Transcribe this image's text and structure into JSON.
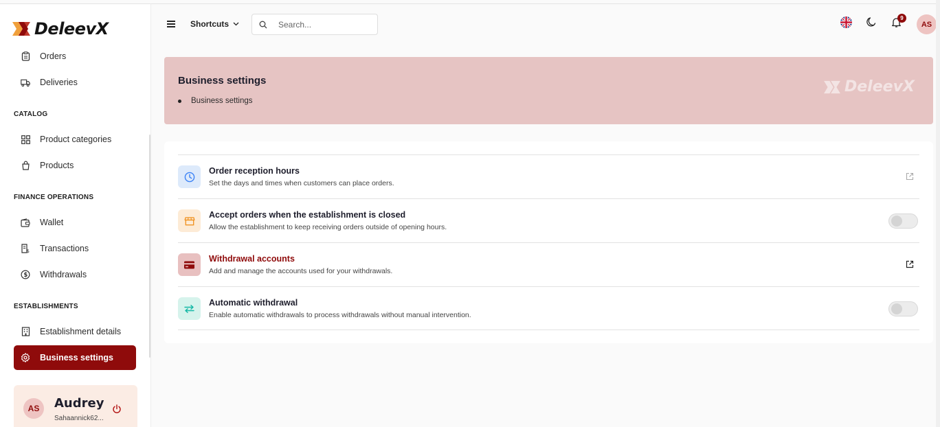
{
  "app": {
    "brand": "DeleevX"
  },
  "sidebar": {
    "items_top": [
      {
        "label": "Orders",
        "icon": "clipboard-icon"
      },
      {
        "label": "Deliveries",
        "icon": "truck-icon"
      }
    ],
    "sections": [
      {
        "title": "CATALOG",
        "items": [
          {
            "label": "Product categories",
            "icon": "grid-icon"
          },
          {
            "label": "Products",
            "icon": "bag-icon"
          }
        ]
      },
      {
        "title": "FINANCE OPERATIONS",
        "items": [
          {
            "label": "Wallet",
            "icon": "wallet-icon"
          },
          {
            "label": "Transactions",
            "icon": "receipt-icon"
          },
          {
            "label": "Withdrawals",
            "icon": "dollar-circle-icon"
          }
        ]
      },
      {
        "title": "ESTABLISHMENTS",
        "items": [
          {
            "label": "Establishment details",
            "icon": "building-icon"
          },
          {
            "label": "Business settings",
            "icon": "gear-icon",
            "active": true
          }
        ]
      }
    ],
    "user": {
      "initials": "AS",
      "name": "Audrey",
      "email": "Sahaannick62..."
    }
  },
  "topbar": {
    "shortcuts_label": "Shortcuts",
    "search_placeholder": "Search...",
    "notifications_count": "9",
    "avatar_initials": "AS"
  },
  "banner": {
    "title": "Business settings",
    "breadcrumb": "Business settings",
    "watermark": "DeleevX"
  },
  "settings": [
    {
      "title": "Order reception hours",
      "description": "Set the days and times when customers can place orders.",
      "control": "link",
      "icon": "clock-icon"
    },
    {
      "title": "Accept orders when the establishment is closed",
      "description": "Allow the establishment to keep receiving orders outside of opening hours.",
      "control": "toggle",
      "enabled": false,
      "icon": "store-icon"
    },
    {
      "title": "Withdrawal accounts",
      "description": "Add and manage the accounts used for your withdrawals.",
      "control": "link",
      "icon": "credit-card-icon"
    },
    {
      "title": "Automatic withdrawal",
      "description": "Enable automatic withdrawals to process withdrawals without manual intervention.",
      "control": "toggle",
      "enabled": false,
      "icon": "swap-arrows-icon"
    }
  ],
  "colors": {
    "accent": "#8f0b0b",
    "banner_bg": "#e6c4c3",
    "user_card_bg": "#fbece4"
  }
}
